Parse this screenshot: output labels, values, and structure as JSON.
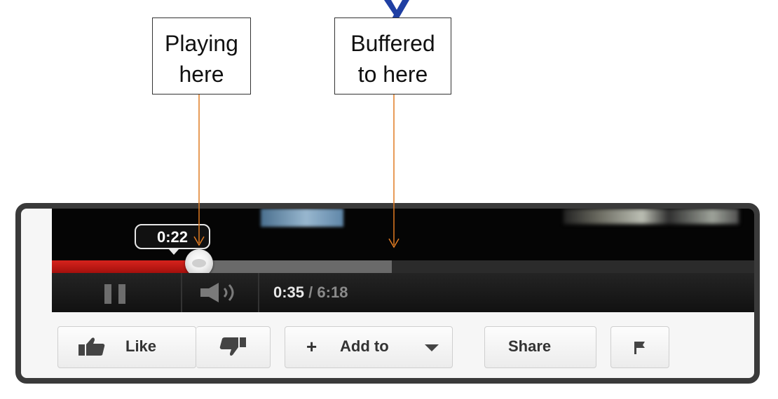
{
  "callouts": {
    "playing": {
      "line1": "Playing",
      "line2": "here"
    },
    "buffered": {
      "line1": "Buffered",
      "line2": "to here"
    }
  },
  "player": {
    "tooltip_time": "0:22",
    "current_time": "0:35",
    "separator": " / ",
    "total_time": "6:18",
    "progress": {
      "played_fraction": 0.21,
      "buffered_fraction": 0.48
    }
  },
  "actions": {
    "like_label": "Like",
    "add_to_label": "Add to",
    "share_label": "Share"
  },
  "icons": {
    "pause": "pause-icon",
    "volume": "volume-icon",
    "like": "thumbs-up-icon",
    "dislike": "thumbs-down-icon",
    "add": "plus-icon",
    "dropdown": "caret-down-icon",
    "flag": "flag-icon"
  },
  "colors": {
    "played": "#c8191a",
    "buffered": "#6a6a6a",
    "track": "#2b2b2b",
    "arrow": "#e07b22",
    "title_fragment": "#1f3fa3"
  }
}
